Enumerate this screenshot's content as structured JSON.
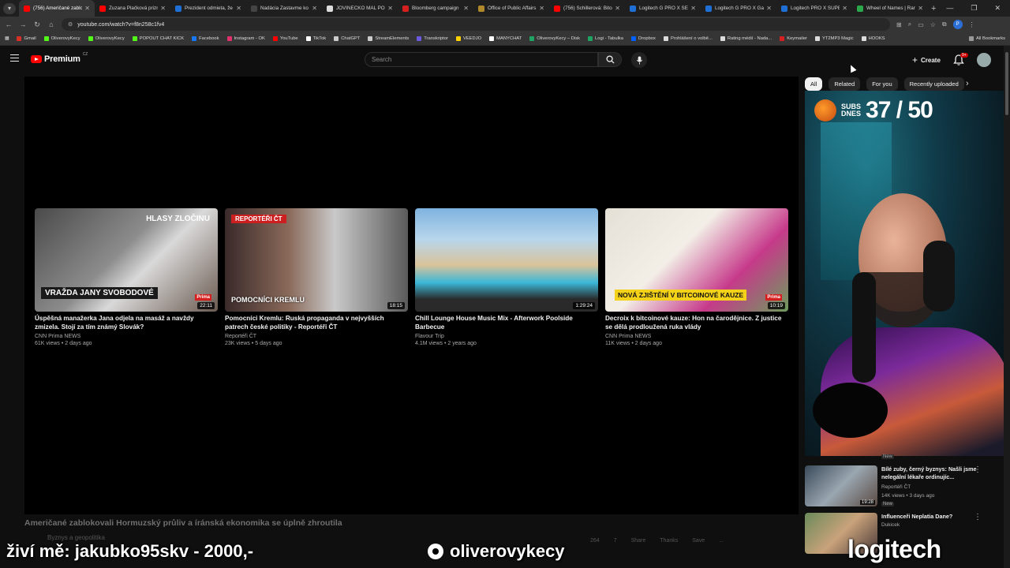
{
  "browser": {
    "tabs": [
      {
        "title": "(756) Američané zablo",
        "color": "#ff0000",
        "active": true
      },
      {
        "title": "Zuzana Plačková prizn",
        "color": "#ff0000",
        "active": false
      },
      {
        "title": "Prezident odmieta, že",
        "color": "#1e6fd6",
        "active": false
      },
      {
        "title": "Nadácia Zastavme ko",
        "color": "#444444",
        "active": false
      },
      {
        "title": "JOVINEČKO MAL PODP",
        "color": "#dddddd",
        "active": false
      },
      {
        "title": "Bloomberg campaign",
        "color": "#d62020",
        "active": false
      },
      {
        "title": "Office of Public Affairs",
        "color": "#b08a2a",
        "active": false
      },
      {
        "title": "(756) Schillerová: Bitco",
        "color": "#ff0000",
        "active": false
      },
      {
        "title": "Logitech G PRO X SE V",
        "color": "#1e6fd6",
        "active": false
      },
      {
        "title": "Logitech G PRO X Gam",
        "color": "#1e6fd6",
        "active": false
      },
      {
        "title": "Logitech PRO X SUPER",
        "color": "#1e6fd6",
        "active": false
      },
      {
        "title": "Wheel of Names | Ran",
        "color": "#2aa84a",
        "active": false
      }
    ],
    "url": "youtube.com/watch?v=f8n258c1fv4",
    "bookmarks": [
      {
        "label": "Gmail",
        "color": "#d93025"
      },
      {
        "label": "OliverovyKecy",
        "color": "#53fc18"
      },
      {
        "label": "OliverovyKecy",
        "color": "#53fc18"
      },
      {
        "label": "POPOUT CHAT KICK",
        "color": "#53fc18"
      },
      {
        "label": "Facebook",
        "color": "#1877f2"
      },
      {
        "label": "Instagram - OK",
        "color": "#e1306c"
      },
      {
        "label": "YouTube",
        "color": "#ff0000"
      },
      {
        "label": "TikTok",
        "color": "#ffffff"
      },
      {
        "label": "ChatGPT",
        "color": "#cccccc"
      },
      {
        "label": "StreamElements",
        "color": "#cccccc"
      },
      {
        "label": "Transkriptor",
        "color": "#6a5ae0"
      },
      {
        "label": "VEEDJO",
        "color": "#ffd200"
      },
      {
        "label": "MANYCHAT",
        "color": "#ffffff"
      },
      {
        "label": "OliverovyKecy – Disk",
        "color": "#1fa463"
      },
      {
        "label": "Logi - Tabulka",
        "color": "#1fa463"
      },
      {
        "label": "Dropbox",
        "color": "#0061ff"
      },
      {
        "label": "Prohlášení o volbě...",
        "color": "#dddddd"
      },
      {
        "label": "Rating médií - Nada...",
        "color": "#dddddd"
      },
      {
        "label": "Keymailer",
        "color": "#d62020"
      },
      {
        "label": "YT2MP3 Magic",
        "color": "#dddddd"
      },
      {
        "label": "HOOKS",
        "color": "#dddddd"
      }
    ],
    "all_bookmarks": "All Bookmarks",
    "profile_initial": "P"
  },
  "youtube": {
    "logo_text": "Premium",
    "country_code": "CZ",
    "search_placeholder": "Search",
    "create_label": "Create",
    "notif_badge": "9+",
    "video_title": "Američané zablokovali Hormuzský průliv a íránská ekonomika se úplně zhroutila",
    "channel_row": "Byznys a geopolitika",
    "actions": [
      "264",
      "7",
      "Share",
      "Thanks",
      "Save",
      "..."
    ],
    "endscreen": [
      {
        "title": "Úspěšná manažerka Jana odjela na masáž a navždy zmizela. Stojí za tím známý Slovák?",
        "channel": "CNN Prima NEWS",
        "meta": "61K views • 2 days ago",
        "duration": "22:11",
        "banner": "VRAŽDA JANY SVOBODOVÉ",
        "tag": "HLASY ZLOČINU"
      },
      {
        "title": "Pomocníci Kremlu: Ruská propaganda v nejvyšších patrech české politiky - Reportéři ČT",
        "channel": "Reportéři ČT",
        "meta": "23K views • 5 days ago",
        "duration": "18:15",
        "banner": "POMOCNÍCI KREMLU",
        "tag": "REPORTÉŘI ČT"
      },
      {
        "title": "Chill Lounge House Music Mix - Afterwork Poolside Barbecue",
        "channel": "Flavour Trip",
        "meta": "4.1M views • 2 years ago",
        "duration": "1:29:24",
        "banner": "",
        "tag": ""
      },
      {
        "title": "Decroix k bitcoinové kauze: Hon na čarodějnice. Z justice se dělá prodloužená ruka vlády",
        "channel": "CNN Prima NEWS",
        "meta": "11K views • 2 days ago",
        "duration": "10:19",
        "banner": "NOVÁ ZJIŠTĚNÍ V BITCOINOVÉ KAUZE",
        "tag": ""
      }
    ],
    "chips": [
      "All",
      "Related",
      "For you",
      "Recently uploaded"
    ],
    "recommendations": [
      {
        "title": "Bílé zuby, černý byznys: Našli jsme nelegální lékaře ordinujíc...",
        "channel": "Reportéři ČT",
        "meta": "14K views • 3 days ago",
        "duration": "19:28",
        "badge": "New"
      },
      {
        "title": "Influenceři Neplatia Dane?",
        "channel": "Dukicek",
        "meta": "",
        "duration": "",
        "badge": ""
      }
    ],
    "top_new_badge": "New"
  },
  "stream_overlay": {
    "subs_label_1": "SUBS",
    "subs_label_2": "DNES",
    "subs_count": "37 / 50",
    "donor_text": "živí mě: jakubko95skv - 2000,-",
    "handle": "oliverovykecy",
    "sponsor": "logitech",
    "cnn_chip": "Prima"
  }
}
